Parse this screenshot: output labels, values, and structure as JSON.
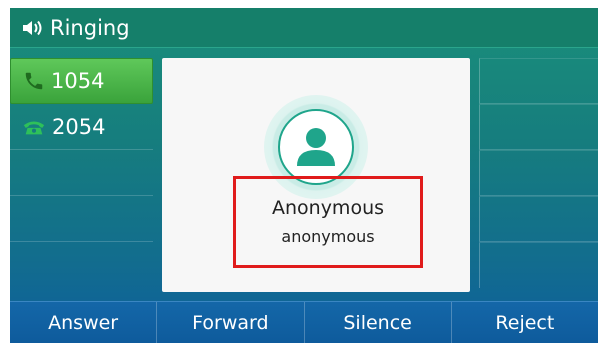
{
  "status_bar": {
    "title": "Ringing"
  },
  "lines": [
    {
      "number": "1054",
      "active": true
    },
    {
      "number": "2054",
      "active": false
    }
  ],
  "caller": {
    "name": "Anonymous",
    "number": "anonymous"
  },
  "softkeys": [
    "Answer",
    "Forward",
    "Silence",
    "Reject"
  ],
  "colors": {
    "screen_bg_top": "#1a8f7a",
    "screen_bg_bottom": "#0e5f9c",
    "active_line": "#4ab84a",
    "highlight_border": "#e01b1b"
  }
}
